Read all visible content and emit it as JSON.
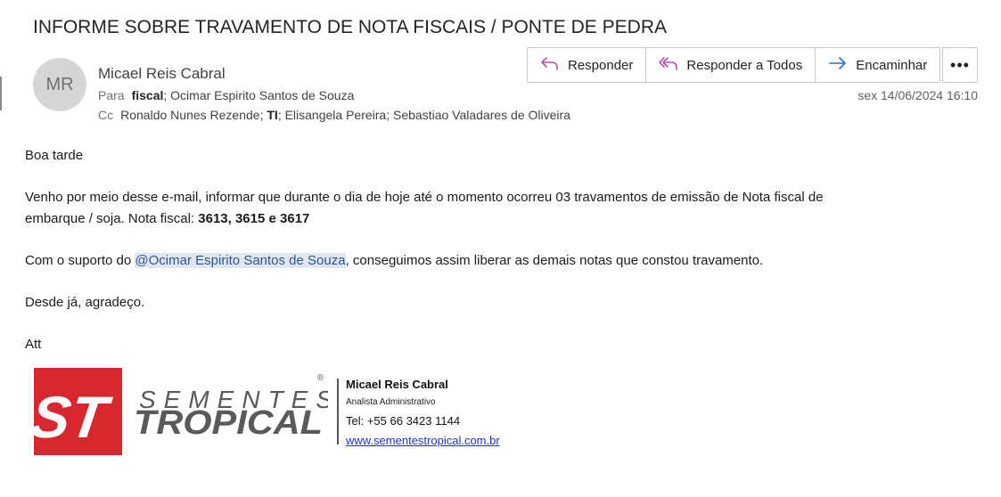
{
  "email": {
    "subject": "INFORME SOBRE TRAVAMENTO DE NOTA FISCAIS / PONTE DE PEDRA",
    "avatar_initials": "MR",
    "sender_name": "Micael Reis Cabral",
    "to_label": "Para",
    "to_bold": "fiscal",
    "to_rest": "; Ocimar Espirito Santos de Souza",
    "cc_label": "Cc",
    "cc_part1": "Ronaldo Nunes Rezende; ",
    "cc_bold": "TI",
    "cc_part2": "; Elisangela Pereira; Sebastiao Valadares de Oliveira",
    "date": "sex 14/06/2024 16:10"
  },
  "actions": {
    "reply": "Responder",
    "reply_all": "Responder a Todos",
    "forward": "Encaminhar",
    "more": "•••"
  },
  "icons": {
    "reply": "reply-icon",
    "reply_all": "reply-all-icon",
    "forward": "forward-arrow-icon",
    "more": "more-options-icon"
  },
  "colors": {
    "reply_icon": "#b455a6",
    "forward_icon": "#1f73c8",
    "logo_red": "#d7282f",
    "logo_gray": "#5a5a5a",
    "link": "#1a35c8",
    "mention_bg": "#e1e6ef"
  },
  "body": {
    "greeting": "Boa tarde",
    "p1_line1": "Venho por meio desse e-mail, informar que durante o dia de hoje até o momento ocorreu 03 travamentos de emissão de Nota fiscal de",
    "p1_line2_prefix": "embarque / soja. Nota fiscal: ",
    "p1_numbers": "3613, 3615 e 3617",
    "p2_prefix": "Com o suporto do ",
    "p2_mention": "@Ocimar Espirito Santos de Souza",
    "p2_suffix": ", conseguimos assim liberar as demais notas que constou travamento.",
    "p3": "Desde já, agradeço.",
    "closing": "Att"
  },
  "signature": {
    "logo_mark": "ST",
    "logo_line1": "SEMENTES",
    "logo_line2": "TROPICAL",
    "logo_registered": "®",
    "name": "Micael Reis Cabral",
    "role": "Analista Administrativo",
    "tel": "Tel: +55 66 3423 1144",
    "website": "www.sementestropical.com.br"
  }
}
